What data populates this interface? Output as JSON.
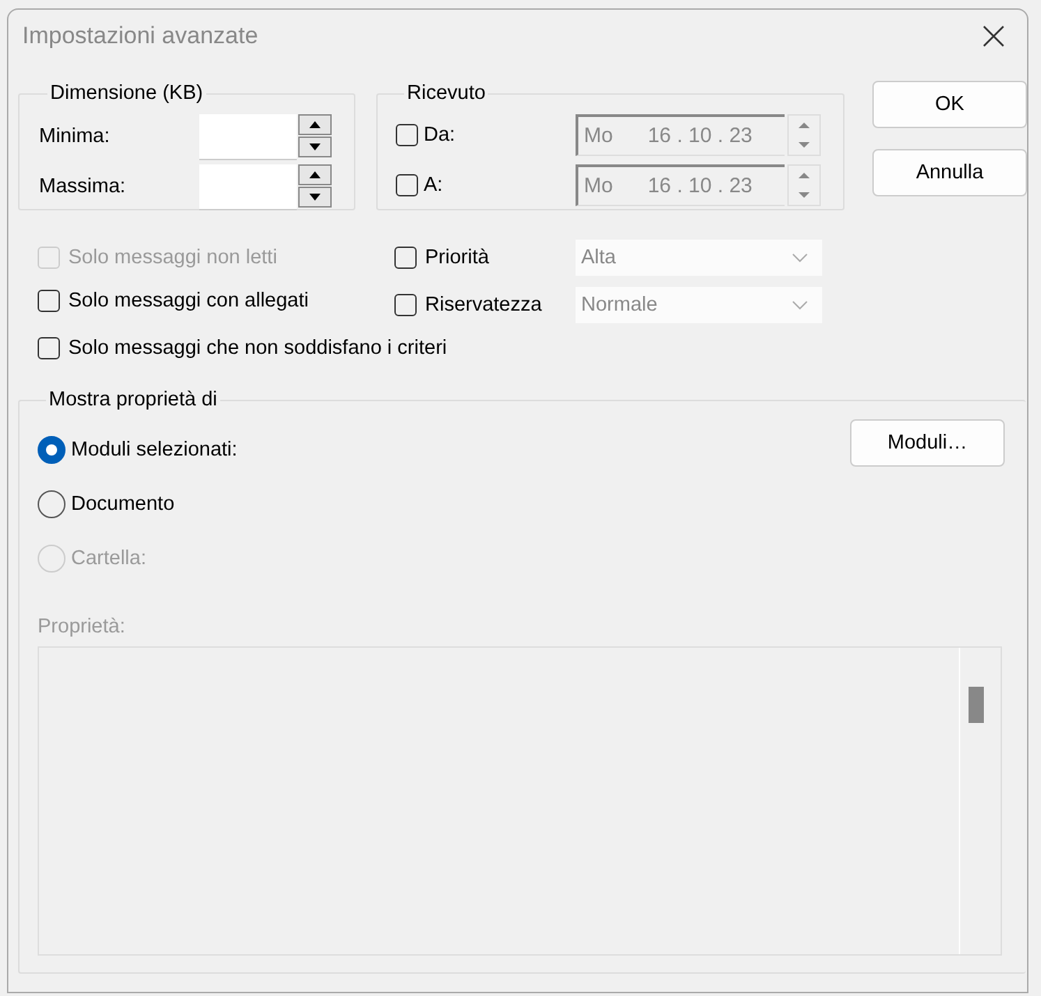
{
  "window": {
    "title": "Impostazioni avanzate"
  },
  "size_group": {
    "title": "Dimensione (KB)",
    "fields": [
      {
        "label": "Minima:"
      },
      {
        "label": "Massima:"
      }
    ]
  },
  "received_group": {
    "title": "Ricevuto",
    "fields": [
      {
        "label": "Da:",
        "checked": false,
        "day": "Mo",
        "date": "16 . 10 . 23"
      },
      {
        "label": "A:",
        "checked": false,
        "day": "Mo",
        "date": "16 . 10 . 23"
      }
    ]
  },
  "buttons": [
    {
      "label": "OK"
    },
    {
      "label": "Annulla"
    }
  ],
  "options": [
    {
      "label": "Solo messaggi non letti",
      "checked": false,
      "disabled": true
    },
    {
      "label": "Solo messaggi con allegati",
      "checked": false,
      "disabled": false
    },
    {
      "label": "Solo messaggi che non soddisfano i criteri",
      "checked": false,
      "disabled": false
    }
  ],
  "filters": [
    {
      "label": "Priorità",
      "checked": false,
      "value": "Alta"
    },
    {
      "label": "Riservatezza",
      "checked": false,
      "value": "Normale"
    }
  ],
  "properties_group": {
    "title": "Mostra proprietà di",
    "radios": [
      {
        "label": "Moduli selezionati:",
        "selected": true,
        "disabled": false
      },
      {
        "label": "Documento",
        "selected": false,
        "disabled": false
      },
      {
        "label": "Cartella:",
        "selected": false,
        "disabled": true
      }
    ],
    "forms_button": "Moduli…",
    "list_label": "Proprietà:",
    "list_disabled": true
  }
}
